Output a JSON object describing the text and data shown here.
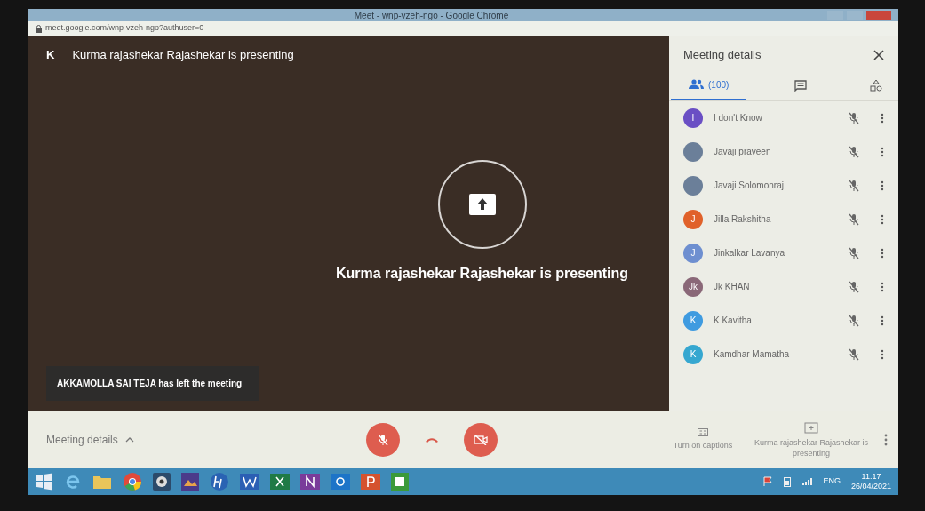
{
  "window": {
    "title": "Meet - wnp-vzeh-ngo - Google Chrome"
  },
  "address_bar": {
    "url": "meet.google.com/wnp-vzeh-ngo?authuser=0"
  },
  "stage": {
    "presenter_initial": "K",
    "presenter_label": "Kurma rajashekar Rajashekar is presenting",
    "center_label": "Kurma rajashekar Rajashekar is presenting",
    "toast": "AKKAMOLLA SAI TEJA has left the meeting"
  },
  "panel": {
    "title": "Meeting details",
    "tabs": [
      {
        "kind": "people",
        "label": "(100)",
        "selected": true
      },
      {
        "kind": "chat",
        "selected": false
      },
      {
        "kind": "activities",
        "selected": false
      }
    ],
    "participants": [
      {
        "name": "I don't Know",
        "kind": "letter",
        "initial": "I",
        "color": "#6a4fc4",
        "muted": true
      },
      {
        "name": "Javaji praveen",
        "kind": "photo",
        "muted": true
      },
      {
        "name": "Javaji Solomonraj",
        "kind": "photo",
        "muted": true
      },
      {
        "name": "Jilla Rakshitha",
        "kind": "letter",
        "initial": "J",
        "color": "#e0612a",
        "muted": true
      },
      {
        "name": "Jinkalkar Lavanya",
        "kind": "letter",
        "initial": "J",
        "color": "#6e8fd0",
        "muted": true
      },
      {
        "name": "Jk KHAN",
        "kind": "letter",
        "initial": "Jk",
        "color": "#8a6878",
        "muted": true
      },
      {
        "name": "K Kavitha",
        "kind": "letter",
        "initial": "K",
        "color": "#3f9be0",
        "muted": true
      },
      {
        "name": "Kamdhar Mamatha",
        "kind": "letter",
        "initial": "K",
        "color": "#36a7d0",
        "muted": true
      }
    ]
  },
  "controls": {
    "details_label": "Meeting details",
    "mic_on": false,
    "camera_on": false,
    "captions_label": "Turn on captions",
    "present_label": "Kurma rajashekar Rajashekar is presenting"
  },
  "taskbar": {
    "language": "ENG",
    "time": "11:17",
    "date": "26/04/2021"
  }
}
